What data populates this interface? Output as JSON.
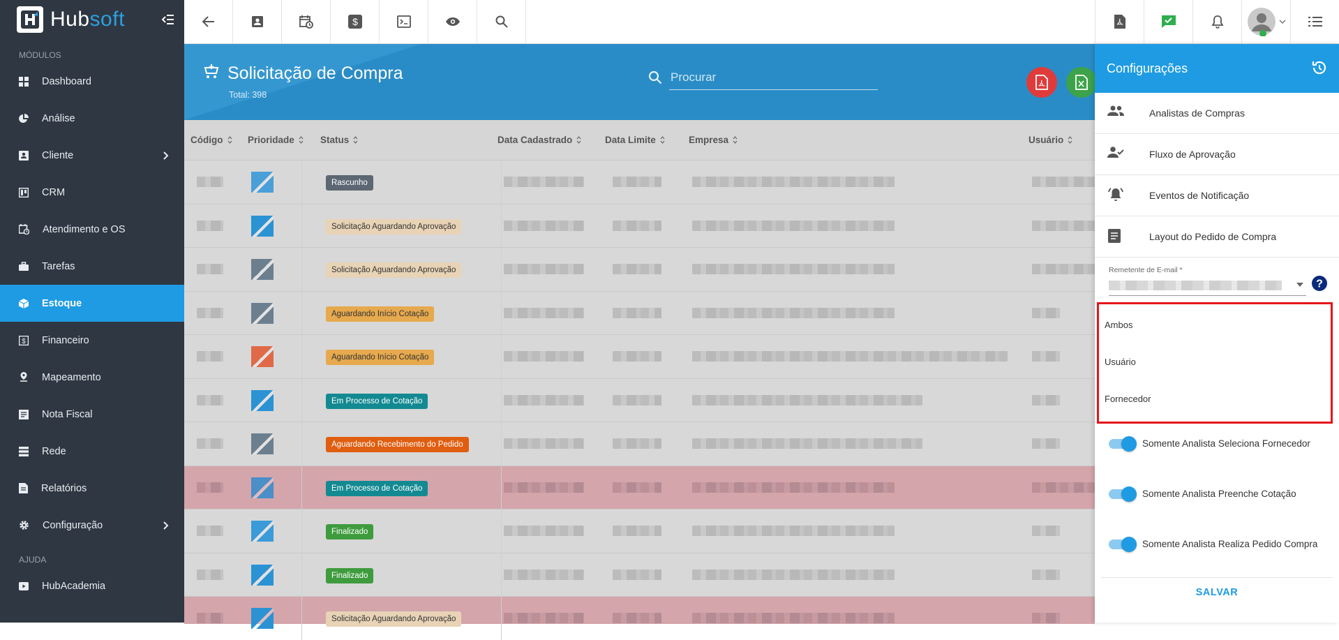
{
  "brand": {
    "part1": "Hub",
    "part2": "soft"
  },
  "sidebar": {
    "section_modules": "MÓDULOS",
    "items": [
      {
        "label": "Dashboard",
        "icon": "dashboard-icon"
      },
      {
        "label": "Análise",
        "icon": "pie-chart-icon"
      },
      {
        "label": "Cliente",
        "icon": "contact-card-icon",
        "chevron": true
      },
      {
        "label": "CRM",
        "icon": "crm-board-icon"
      },
      {
        "label": "Atendimento e OS",
        "icon": "calendar-clock-icon"
      },
      {
        "label": "Tarefas",
        "icon": "briefcase-icon"
      },
      {
        "label": "Estoque",
        "icon": "box-icon",
        "active": true
      },
      {
        "label": "Financeiro",
        "icon": "money-icon"
      },
      {
        "label": "Mapeamento",
        "icon": "map-pin-icon"
      },
      {
        "label": "Nota Fiscal",
        "icon": "receipt-icon"
      },
      {
        "label": "Rede",
        "icon": "server-icon"
      },
      {
        "label": "Relatórios",
        "icon": "report-icon"
      },
      {
        "label": "Configuração",
        "icon": "gear-icon",
        "chevron": true
      }
    ],
    "section_help": "AJUDA",
    "help_items": [
      {
        "label": "HubAcademia",
        "icon": "youtube-icon"
      }
    ]
  },
  "page": {
    "title": "Solicitação de Compra",
    "total": "Total: 398",
    "search_placeholder": "Procurar"
  },
  "table": {
    "columns": [
      "Código",
      "Prioridade",
      "Status",
      "Data Cadastrado",
      "Data Limite",
      "Empresa",
      "Usuário"
    ],
    "rows": [
      {
        "status": "Rascunho",
        "status_color": "#5c6773",
        "status_text": "#ffffff",
        "prio_color": "#4a9fd8",
        "highlight": false
      },
      {
        "status": "Solicitação Aguardando Aprovação",
        "status_color": "#e8d3b6",
        "status_text": "#333333",
        "prio_color": "#2b92d4",
        "highlight": false
      },
      {
        "status": "Solicitação Aguardando Aprovação",
        "status_color": "#e8d3b6",
        "status_text": "#333333",
        "prio_color": "#6c7f8f",
        "highlight": false
      },
      {
        "status": "Aguardando Início Cotação",
        "status_color": "#e6a94d",
        "status_text": "#333333",
        "prio_color": "#6c7f8f",
        "highlight": false
      },
      {
        "status": "Aguardando Início Cotação",
        "status_color": "#e6a94d",
        "status_text": "#333333",
        "prio_color": "#e06a48",
        "highlight": false
      },
      {
        "status": "Em Processo de Cotação",
        "status_color": "#138a92",
        "status_text": "#ffffff",
        "prio_color": "#2b92d4",
        "highlight": false
      },
      {
        "status": "Aguardando Recebimento do Pedido",
        "status_color": "#e05e10",
        "status_text": "#ffffff",
        "prio_color": "#6c7f8f",
        "highlight": false
      },
      {
        "status": "Em Processo de Cotação",
        "status_color": "#138a92",
        "status_text": "#ffffff",
        "prio_color": "#4a8fc8",
        "highlight": true
      },
      {
        "status": "Finalizado",
        "status_color": "#3e9b3e",
        "status_text": "#ffffff",
        "prio_color": "#3b9ad8",
        "highlight": false
      },
      {
        "status": "Finalizado",
        "status_color": "#3e9b3e",
        "status_text": "#ffffff",
        "prio_color": "#2b92d4",
        "highlight": false
      },
      {
        "status": "Solicitação Aguardando Aprovação",
        "status_color": "#e8d3b6",
        "status_text": "#333333",
        "prio_color": "#2b92d4",
        "highlight": true
      }
    ]
  },
  "panel": {
    "title": "Configurações",
    "menu": [
      {
        "label": "Analistas de Compras",
        "icon": "people-icon"
      },
      {
        "label": "Fluxo de Aprovação",
        "icon": "person-check-icon"
      },
      {
        "label": "Eventos de Notificação",
        "icon": "bell-alert-icon"
      },
      {
        "label": "Layout do Pedido de Compra",
        "icon": "document-icon"
      }
    ],
    "email_label": "Remetente de E-mail *",
    "dropdown_options": [
      "Ambos",
      "Usuário",
      "Fornecedor"
    ],
    "toggles": [
      {
        "label": "Somente Analista Seleciona Fornecedor",
        "on": true
      },
      {
        "label": "Somente Analista Preenche Cotação",
        "on": true
      },
      {
        "label": "Somente Analista Realiza Pedido Compra",
        "on": true
      }
    ],
    "save": "SALVAR"
  },
  "colors": {
    "accent": "#1e9be3",
    "sidebar": "#2f3742",
    "highlight_border": "#e5141b"
  }
}
